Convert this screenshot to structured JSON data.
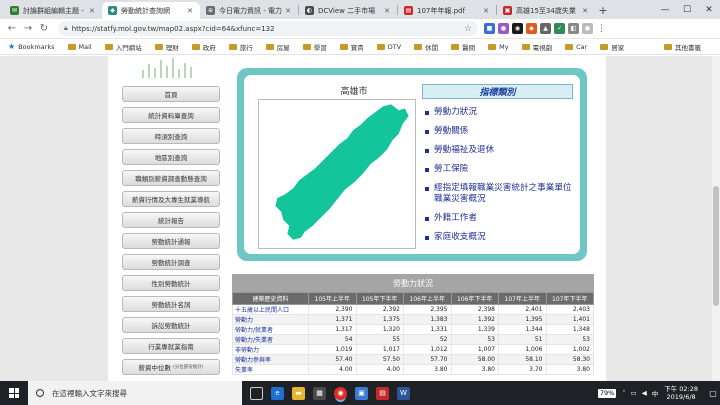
{
  "tabs": [
    {
      "label": "討論群組編輯主題 -",
      "color": "#2e7d32",
      "glyph": "✉"
    },
    {
      "label": "勞動統計查詢網",
      "color": "#2a8a8a",
      "glyph": "◆"
    },
    {
      "label": "今日電力資訊 - 電力",
      "color": "#6b6b6b",
      "glyph": "⊕"
    },
    {
      "label": "DCView 二手市場",
      "color": "#4a4a4a",
      "glyph": "◐"
    },
    {
      "label": "107年年報.pdf",
      "color": "#c62828",
      "glyph": "▤"
    },
    {
      "label": "高雄15至34歲失業",
      "color": "#c62828",
      "glyph": "▣"
    }
  ],
  "address": {
    "url": "https://statfy.mol.gov.tw/map02.aspx?cid=64&xfunc=132"
  },
  "bookmarks": {
    "label": "Bookmarks",
    "items": [
      "Mail",
      "入門網站",
      "理財",
      "政府",
      "旅行",
      "房屋",
      "學習",
      "寶貴",
      "DTV",
      "休閒",
      "醫問",
      "My",
      "電視劇",
      "Car",
      "居家"
    ],
    "other": "其他書籤"
  },
  "menu": [
    {
      "label": "首頁"
    },
    {
      "label": "統計資料庫查詢"
    },
    {
      "label": "時須別查詢"
    },
    {
      "label": "地區別查詢"
    },
    {
      "label": "職類別薪資調查動態查詢"
    },
    {
      "label": "薪資行情及大專生就業導航"
    },
    {
      "label": "統計報告"
    },
    {
      "label": "勞動統計通報"
    },
    {
      "label": "勞動統計調查"
    },
    {
      "label": "性別勞動統計"
    },
    {
      "label": "勞動統計名詞"
    },
    {
      "label": "訴訟勞動統計"
    },
    {
      "label": "行業專就業指南"
    },
    {
      "label": "薪資中位數",
      "note": "(分位部份統計)"
    }
  ],
  "map": {
    "title": "高雄市",
    "fill": "#14c49b"
  },
  "categories": {
    "header": "指標類別",
    "items": [
      "勞動力狀況",
      "勞動關係",
      "勞動福祉及退休",
      "勞工保險",
      "經指定填報職業災害統計之事業單位職業災害概況",
      "外籍工作者",
      "家庭收支概況"
    ]
  },
  "stats": {
    "title": "勞動力狀況",
    "columns": [
      "建築歷史資料",
      "105年上半年",
      "105年下半年",
      "106年上半年",
      "106年下半年",
      "107年上半年",
      "107年下半年"
    ],
    "rows": [
      {
        "label": "十五歲以上民間人口",
        "values": [
          "2,390",
          "2,392",
          "2,395",
          "2,398",
          "2,401",
          "2,403"
        ]
      },
      {
        "label": "勞動力",
        "values": [
          "1,371",
          "1,375",
          "1,383",
          "1,392",
          "1,395",
          "1,401"
        ]
      },
      {
        "label": "勞動力/就業者",
        "values": [
          "1,317",
          "1,320",
          "1,331",
          "1,339",
          "1,344",
          "1,348"
        ]
      },
      {
        "label": "勞動力/失業者",
        "values": [
          "54",
          "55",
          "52",
          "53",
          "51",
          "53"
        ]
      },
      {
        "label": "非勞動力",
        "values": [
          "1,019",
          "1,017",
          "1,012",
          "1,007",
          "1,006",
          "1,002"
        ]
      },
      {
        "label": "勞動力參與率",
        "values": [
          "57.40",
          "57.50",
          "57.70",
          "58.00",
          "58.10",
          "58.30"
        ]
      },
      {
        "label": "失業率",
        "values": [
          "4.00",
          "4.00",
          "3.80",
          "3.80",
          "3.70",
          "3.80"
        ]
      }
    ]
  },
  "taskbar": {
    "search_placeholder": "在這裡輸入文字來搜尋",
    "battery": "79%",
    "time": "下午 02:28",
    "date": "2019/6/8"
  },
  "colors": {
    "panel": "#6fc7c5",
    "link": "#1f2f96"
  }
}
